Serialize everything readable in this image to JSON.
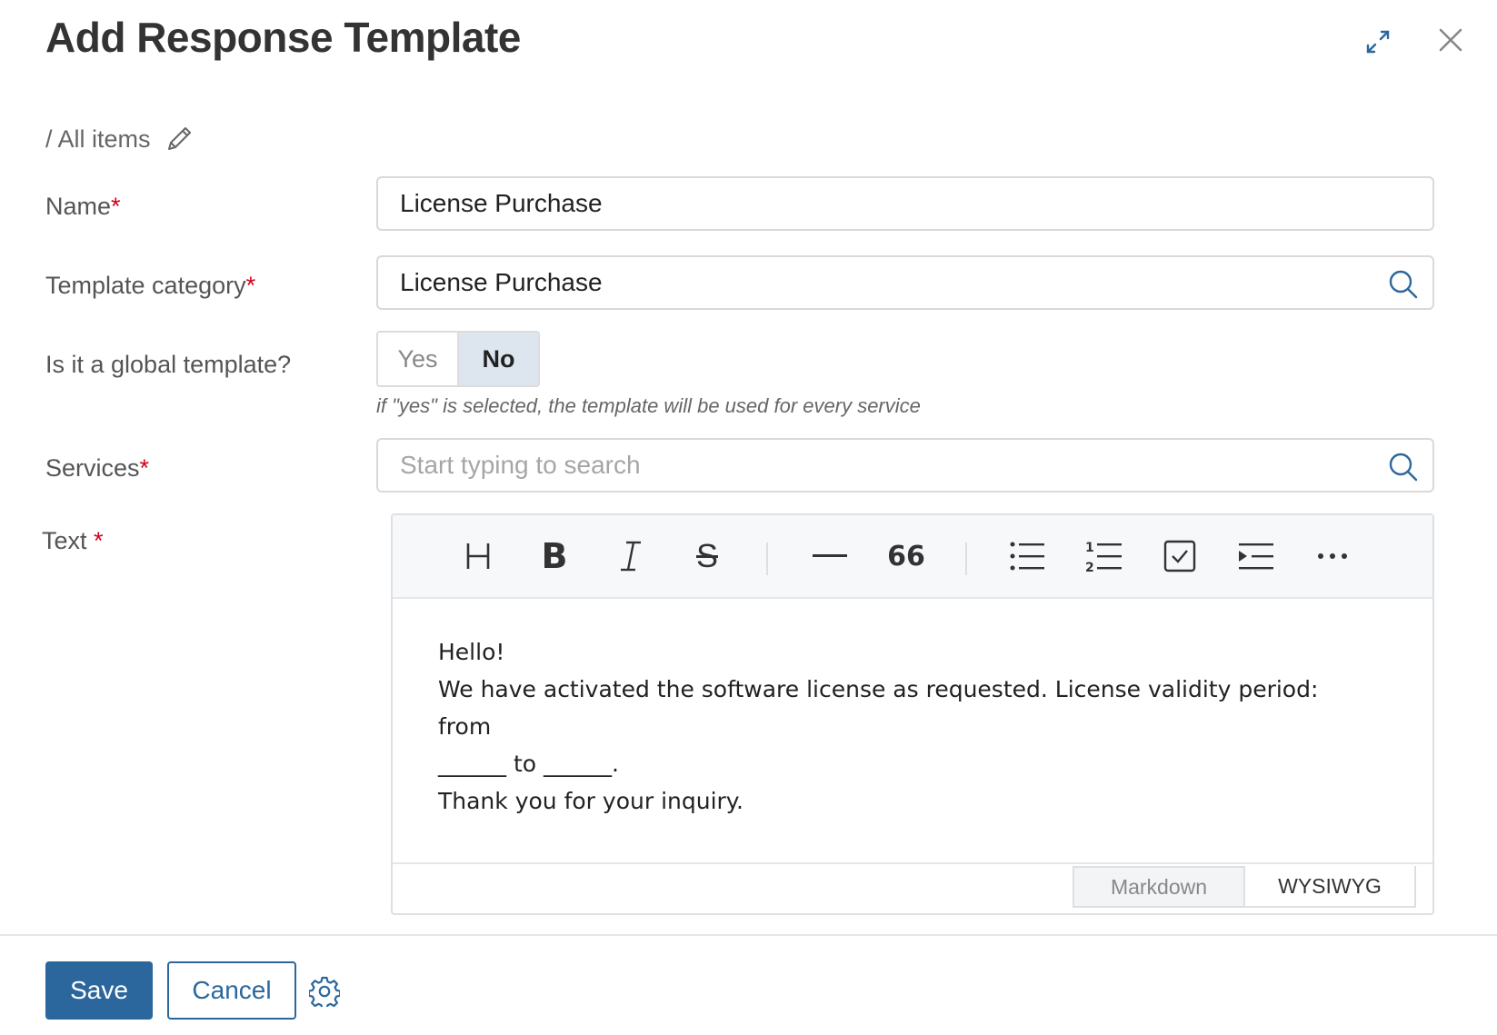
{
  "header": {
    "title": "Add Response Template",
    "expand_icon": "expand-icon",
    "close_icon": "close-icon"
  },
  "breadcrumb": {
    "text": "/ All items",
    "edit_icon": "pencil-icon"
  },
  "form": {
    "name": {
      "label": "Name",
      "required": "*",
      "value": "License Purchase"
    },
    "category": {
      "label": "Template category",
      "required": "*",
      "value": "License Purchase"
    },
    "global": {
      "label": "Is it a global template?",
      "yes": "Yes",
      "no": "No",
      "selected": "No",
      "hint": "if \"yes\" is selected, the template will be used for every service"
    },
    "services": {
      "label": "Services",
      "required": "*",
      "placeholder": "Start typing to search"
    },
    "text": {
      "label": "Text",
      "required": "*"
    }
  },
  "editor": {
    "toolbar": [
      "heading-icon",
      "bold-icon",
      "italic-icon",
      "strikethrough-icon",
      "horizontal-rule-icon",
      "quote-icon",
      "bullet-list-icon",
      "numbered-list-icon",
      "checkbox-list-icon",
      "indent-icon",
      "more-icon"
    ],
    "lines": {
      "l1": "Hello!",
      "l2": "We have activated the software license as requested. License validity period: from",
      "l3": "______ to ______.",
      "l4": "Thank you for your inquiry."
    },
    "modes": {
      "markdown": "Markdown",
      "wysiwyg": "WYSIWYG",
      "active": "WYSIWYG"
    }
  },
  "footer": {
    "save": "Save",
    "cancel": "Cancel",
    "settings_icon": "gear-icon"
  },
  "colors": {
    "primary": "#2b679d",
    "required": "#d0021b",
    "toggle_selected": "#dde5ee"
  }
}
